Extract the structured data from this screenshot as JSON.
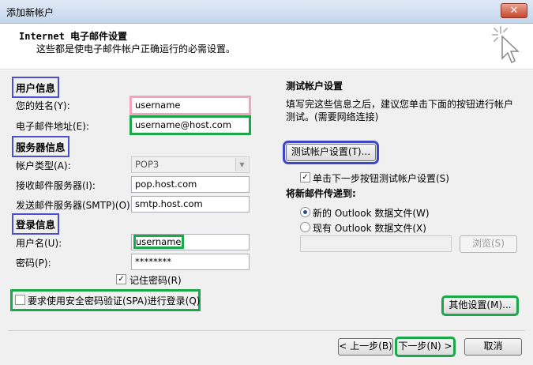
{
  "window": {
    "title": "添加新帐户",
    "close_glyph": "✕"
  },
  "header": {
    "title": "Internet 电子邮件设置",
    "subtitle": "这些都是使电子邮件帐户正确运行的必需设置。"
  },
  "user_info": {
    "section": "用户信息",
    "name_label": "您的姓名(Y):",
    "name_value": "username",
    "email_label": "电子邮件地址(E):",
    "email_value": "username@host.com"
  },
  "server_info": {
    "section": "服务器信息",
    "account_type_label": "帐户类型(A):",
    "account_type_value": "POP3",
    "incoming_label": "接收邮件服务器(I):",
    "incoming_value": "pop.host.com",
    "outgoing_label": "发送邮件服务器(SMTP)(O):",
    "outgoing_value": "smtp.host.com"
  },
  "login_info": {
    "section": "登录信息",
    "username_label": "用户名(U):",
    "username_value": "username",
    "password_label": "密码(P):",
    "password_value": "********",
    "remember_label": "记住密码(R)",
    "remember_checked": true,
    "spa_label": "要求使用安全密码验证(SPA)进行登录(Q)",
    "spa_checked": false
  },
  "test_settings": {
    "section": "测试帐户设置",
    "description": "填写完这些信息之后，建议您单击下面的按钮进行帐户测试。(需要网络连接)",
    "test_button": "测试帐户设置(T)...",
    "auto_test_label": "单击下一步按钮测试帐户设置(S)",
    "auto_test_checked": true,
    "deliver_label": "将新邮件传递到:",
    "new_pst_label": "新的 Outlook 数据文件(W)",
    "existing_pst_label": "现有 Outlook 数据文件(X)",
    "existing_pst_path": "",
    "browse_button": "浏览(S)",
    "more_settings_button": "其他设置(M)..."
  },
  "footer": {
    "back_button": "< 上一步(B)",
    "next_button": "下一步(N) >",
    "cancel_button": "取消"
  },
  "colors": {
    "highlight_green": "#1aa84a",
    "highlight_blue": "#3e46c8",
    "highlight_pink": "#f4a3bf"
  },
  "icons": {
    "header_icon": "cursor-sparkle-icon"
  }
}
